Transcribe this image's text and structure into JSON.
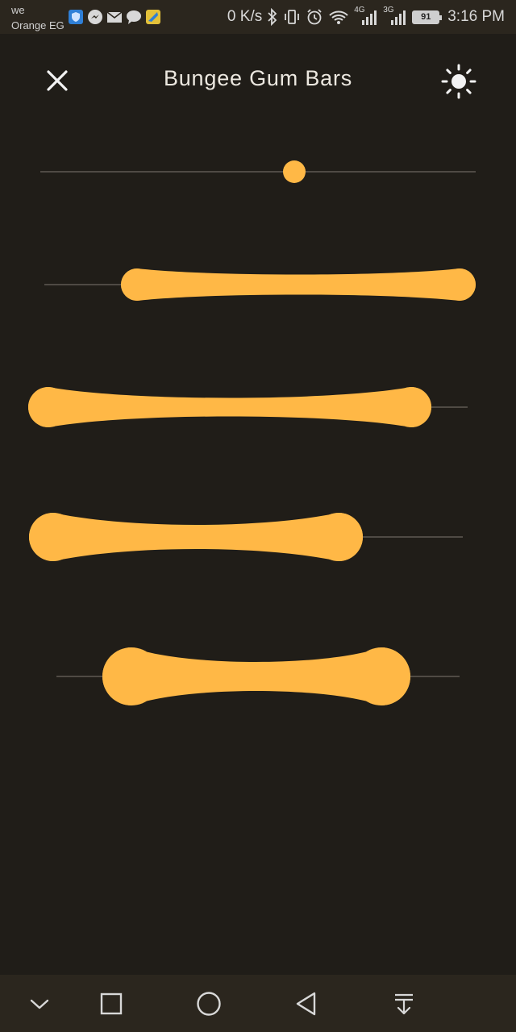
{
  "status_bar": {
    "carrier_line1": "we",
    "carrier_line2": "Orange EG",
    "net_speed": "0 K/s",
    "signal1_label": "4G",
    "signal2_label": "3G",
    "battery_level": "91",
    "time": "3:16 PM",
    "notification_icons": [
      "shield-icon",
      "messenger-icon",
      "mail-icon",
      "chat-icon",
      "app-icon"
    ]
  },
  "app_bar": {
    "title": "Bungee Gum Bars",
    "close_icon": "close-icon",
    "theme_icon": "sun-icon"
  },
  "colors": {
    "background": "#201d18",
    "accent": "#ffb846",
    "track": "#5f5a52",
    "system_bar": "#2b261e"
  },
  "sliders": [
    {
      "type": "single",
      "value": 0.58
    },
    {
      "type": "range",
      "start": 0.21,
      "end": 1.0
    },
    {
      "type": "range",
      "start": 0.0,
      "end": 0.87
    },
    {
      "type": "range",
      "start": 0.0,
      "end": 0.77
    },
    {
      "type": "range",
      "start": 0.2,
      "end": 0.88
    }
  ],
  "nav_bar": {
    "items": [
      "chevron-down-icon",
      "recents-square-icon",
      "home-circle-icon",
      "back-triangle-icon",
      "notification-pull-icon"
    ]
  }
}
